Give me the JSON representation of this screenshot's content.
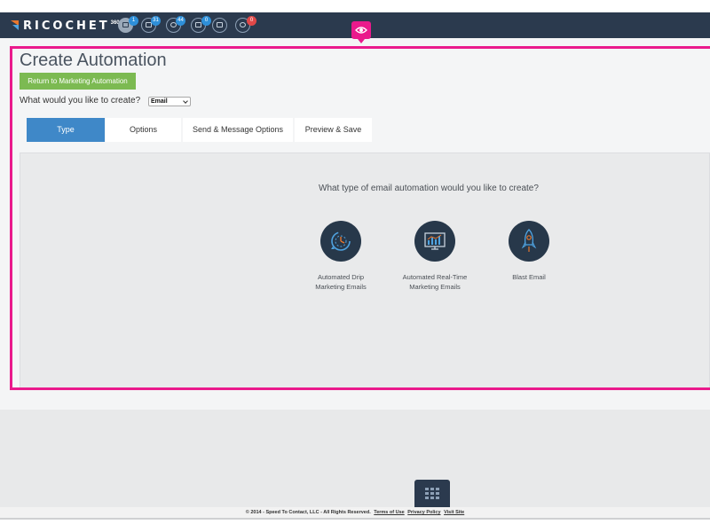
{
  "brand": {
    "name": "RICOCHET",
    "sup": "360"
  },
  "nav": {
    "icons": [
      {
        "name": "dashboard-icon",
        "badge": "1",
        "badge_color": "#2e8fd8"
      },
      {
        "name": "document-icon",
        "badge": "31",
        "badge_color": "#2e8fd8"
      },
      {
        "name": "chat-icon",
        "badge": "44",
        "badge_color": "#2e8fd8"
      },
      {
        "name": "mail-icon",
        "badge": "0",
        "badge_color": "#2e8fd8"
      },
      {
        "name": "inbox-icon",
        "badge": "",
        "badge_color": ""
      },
      {
        "name": "message-icon",
        "badge": "0",
        "badge_color": "#e04848"
      }
    ]
  },
  "page": {
    "title": "Create Automation",
    "return_button": "Return to Marketing Automation",
    "create_label": "What would you like to create?",
    "create_select": "Email"
  },
  "tabs": [
    {
      "label": "Type",
      "active": true
    },
    {
      "label": "Options",
      "active": false
    },
    {
      "label": "Send & Message Options",
      "active": false
    },
    {
      "label": "Preview & Save",
      "active": false
    }
  ],
  "content": {
    "question": "What type of email automation would you like to create?",
    "options": [
      {
        "line1": "Automated Drip",
        "line2": "Marketing Emails",
        "icon": "drip-clock-icon"
      },
      {
        "line1": "Automated Real-Time",
        "line2": "Marketing Emails",
        "icon": "monitor-chart-icon"
      },
      {
        "line1": "Blast Email",
        "line2": "",
        "icon": "rocket-icon"
      }
    ]
  },
  "footer": {
    "copyright": "© 2014 - Speed To Contact, LLC - All Rights Reserved.",
    "terms": "Terms of Use",
    "privacy": "Privacy Policy",
    "visit": "Visit Site"
  },
  "colors": {
    "header": "#2b3a4e",
    "accent_green": "#7cba52",
    "tab_active": "#3f88c8",
    "highlight": "#ea1a8c"
  }
}
